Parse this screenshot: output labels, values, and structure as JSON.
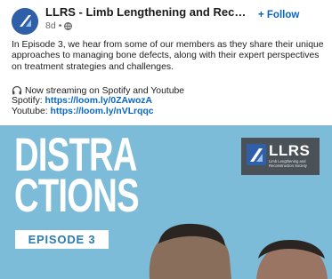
{
  "post": {
    "author": "LLRS - Limb Lengthening and Recon-...",
    "time_ago": "8d",
    "follow_label": "+ Follow",
    "description": "In Episode 3, we hear from some of our members as they share their unique approaches to managing bone defects, along with their expert perspectives on treatment strategies and challenges.",
    "streaming_text": "Now streaming on Spotify and Youtube",
    "spotify_label": "Spotify:",
    "spotify_link": "https://loom.ly/0ZAwozA",
    "youtube_label": "Youtube:",
    "youtube_link": "https://loom.ly/nVLrqqc"
  },
  "image": {
    "title_line1": "DISTRA",
    "title_line2": "CTIONS",
    "episode_label": "EPISODE 3",
    "badge_text": "LLRS",
    "badge_subtext": "Limb Lengthening and Reconstruction Society"
  },
  "colors": {
    "link": "#0a66c2",
    "image_background": "#7dbcd8",
    "badge_background": "#4a5258"
  },
  "icons": {
    "avatar": "llrs-logo-icon",
    "visibility": "globe-icon",
    "streaming": "headphones-icon"
  }
}
